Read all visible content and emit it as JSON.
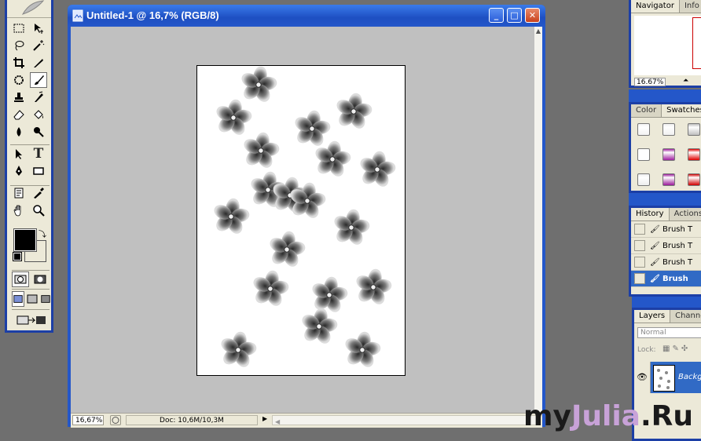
{
  "document": {
    "title": "Untitled-1 @ 16,7% (RGB/8)",
    "zoom": "16,67%",
    "doc_info": "Doc: 10,6M/10,3M"
  },
  "window_buttons": {
    "minimize": "_",
    "maximize": "□",
    "close": "✕"
  },
  "toolbox": {
    "tools": [
      "rectangular-marquee",
      "move",
      "lasso",
      "magic-wand",
      "crop",
      "slice",
      "healing-brush",
      "brush",
      "clone-stamp",
      "history-brush",
      "eraser",
      "paint-bucket",
      "blur",
      "dodge",
      "path-selection",
      "type",
      "pen",
      "rectangle-shape",
      "notes",
      "eyedropper",
      "hand",
      "zoom"
    ],
    "type_tool_label": "T",
    "foreground_color": "#000000",
    "background_color": "#ffffff"
  },
  "navigator": {
    "tabs": [
      "Navigator",
      "Info"
    ],
    "zoom": "16.67%"
  },
  "color_panel": {
    "tabs": [
      "Color",
      "Swatches"
    ],
    "swatch_colors": [
      "#f3f3f3",
      "#f0f0f0",
      "#bfbfbf",
      "#ffffff",
      "#a01fa0",
      "#e00000",
      "#eeeeee",
      "#9a1a9a",
      "#d00000"
    ]
  },
  "history": {
    "tabs": [
      "History",
      "Actions"
    ],
    "items": [
      "Brush T",
      "Brush T",
      "Brush T",
      "Brush"
    ]
  },
  "layers": {
    "tabs": [
      "Layers",
      "Channels"
    ],
    "blend_mode": "Normal",
    "lock_label": "Lock:",
    "layer_name": "Backgr"
  },
  "watermark": {
    "part1": "my",
    "part2": "Julia",
    "part3": ".Ru",
    "color_dark": "#1a1a1a",
    "color_accent": "#c8a2d8"
  }
}
